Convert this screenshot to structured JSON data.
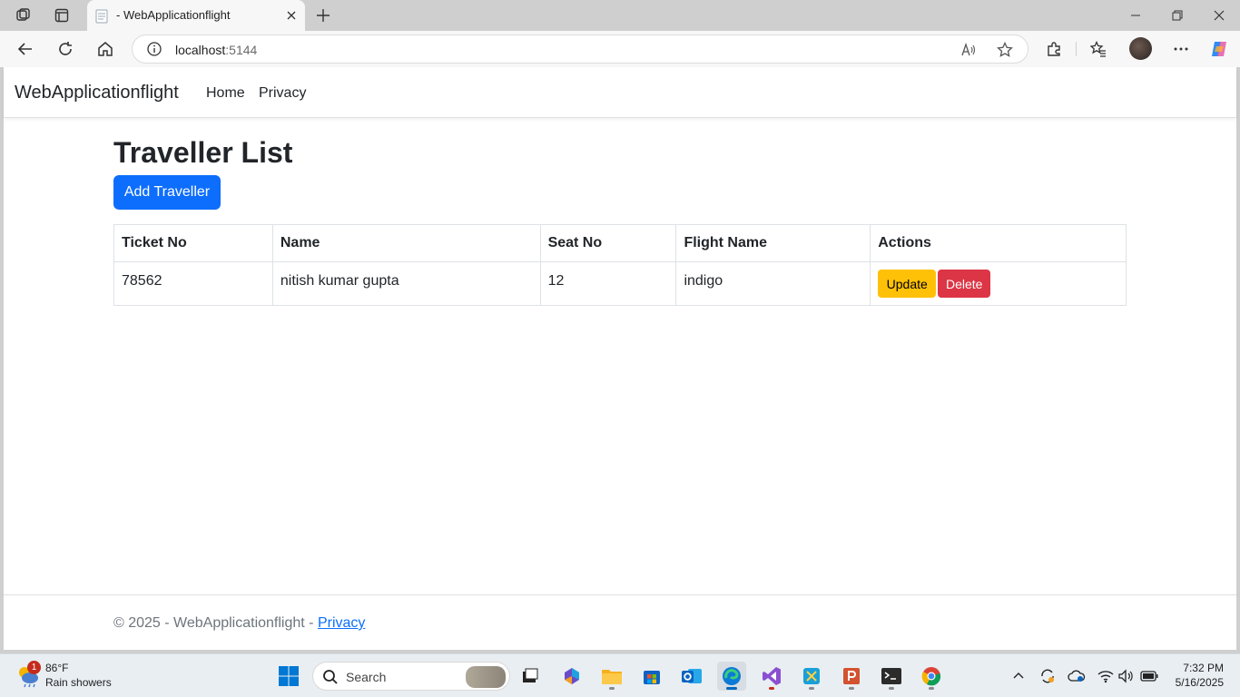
{
  "browser": {
    "tab_title": "- WebApplicationflight",
    "address_host": "localhost",
    "address_port": ":5144"
  },
  "nav": {
    "brand": "WebApplicationflight",
    "links": [
      "Home",
      "Privacy"
    ]
  },
  "main": {
    "heading": "Traveller List",
    "add_button": "Add Traveller",
    "table": {
      "headers": [
        "Ticket No",
        "Name",
        "Seat No",
        "Flight Name",
        "Actions"
      ],
      "rows": [
        {
          "ticket_no": "78562",
          "name": "nitish kumar gupta",
          "seat_no": "12",
          "flight_name": "indigo",
          "update_label": "Update",
          "delete_label": "Delete"
        }
      ]
    }
  },
  "footer": {
    "text": "© 2025 - WebApplicationflight - ",
    "link": "Privacy"
  },
  "taskbar": {
    "weather_badge": "1",
    "weather_temp": "86°F",
    "weather_desc": "Rain showers",
    "search_placeholder": "Search",
    "time": "7:32 PM",
    "date": "5/16/2025"
  },
  "colors": {
    "primary": "#0d6efd",
    "warning": "#ffc107",
    "danger": "#dc3545"
  }
}
